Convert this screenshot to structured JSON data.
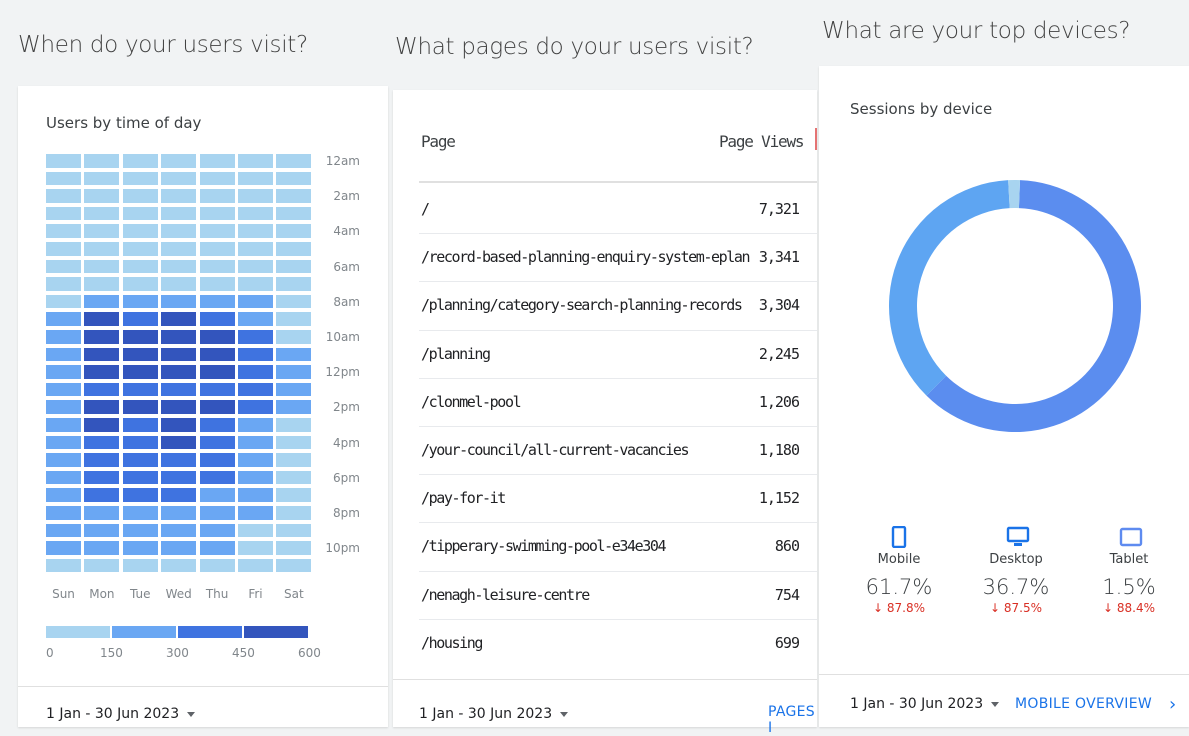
{
  "panels": {
    "visits": {
      "heading": "When do your users visit?",
      "card_title": "Users by time of day",
      "hour_labels": [
        "12am",
        "2am",
        "4am",
        "6am",
        "8am",
        "10am",
        "12pm",
        "2pm",
        "4pm",
        "6pm",
        "8pm",
        "10pm"
      ],
      "days": [
        "Sun",
        "Mon",
        "Tue",
        "Wed",
        "Thu",
        "Fri",
        "Sat"
      ],
      "legend_ticks": [
        "0",
        "150",
        "300",
        "450",
        "600"
      ],
      "legend_colors": [
        "#a8d4f0",
        "#6aa7f3",
        "#3f73e0",
        "#3355bd"
      ],
      "date_range": "1 Jan - 30 Jun 2023"
    },
    "pages": {
      "heading": "What pages do your users visit?",
      "col_page": "Page",
      "col_views": "Page Views",
      "rows": [
        {
          "page": "/",
          "views": "7,321"
        },
        {
          "page": "/record-based-planning-enquiry-system-eplan",
          "views": "3,341"
        },
        {
          "page": "/planning/category-search-planning-records",
          "views": "3,304"
        },
        {
          "page": "/planning",
          "views": "2,245"
        },
        {
          "page": "/clonmel-pool",
          "views": "1,206"
        },
        {
          "page": "/your-council/all-current-vacancies",
          "views": "1,180"
        },
        {
          "page": "/pay-for-it",
          "views": "1,152"
        },
        {
          "page": "/tipperary-swimming-pool-e34e304",
          "views": "860"
        },
        {
          "page": "/nenagh-leisure-centre",
          "views": "754"
        },
        {
          "page": "/housing",
          "views": "699"
        }
      ],
      "date_range": "1 Jan - 30 Jun 2023",
      "link": "PAGES I"
    },
    "devices": {
      "heading": "What are your top devices?",
      "card_title": "Sessions by device",
      "items": [
        {
          "name": "Mobile",
          "pct": "61.7%",
          "change": "↓ 87.8%",
          "share": 61.7,
          "color": "#5b8def",
          "icon": "phone-icon"
        },
        {
          "name": "Desktop",
          "pct": "36.7%",
          "change": "↓ 87.5%",
          "share": 36.7,
          "color": "#5ea5f2",
          "icon": "desktop-icon"
        },
        {
          "name": "Tablet",
          "pct": "1.5%",
          "change": "↓ 88.4%",
          "share": 1.5,
          "color": "#a8d4f0",
          "icon": "tablet-icon"
        }
      ],
      "date_range": "1 Jan - 30 Jun 2023",
      "link": "MOBILE OVERVIEW"
    }
  },
  "chart_data": [
    {
      "type": "heatmap",
      "title": "Users by time of day",
      "x": [
        "Sun",
        "Mon",
        "Tue",
        "Wed",
        "Thu",
        "Fri",
        "Sat"
      ],
      "y": [
        "12am",
        "1am",
        "2am",
        "3am",
        "4am",
        "5am",
        "6am",
        "7am",
        "8am",
        "9am",
        "10am",
        "11am",
        "12pm",
        "1pm",
        "2pm",
        "3pm",
        "4pm",
        "5pm",
        "6pm",
        "7pm",
        "8pm",
        "9pm",
        "10pm",
        "11pm"
      ],
      "scale": [
        0,
        600
      ],
      "levels": [
        [
          0,
          0,
          0,
          0,
          0,
          0,
          0
        ],
        [
          0,
          0,
          0,
          0,
          0,
          0,
          0
        ],
        [
          0,
          0,
          0,
          0,
          0,
          0,
          0
        ],
        [
          0,
          0,
          0,
          0,
          0,
          0,
          0
        ],
        [
          0,
          0,
          0,
          0,
          0,
          0,
          0
        ],
        [
          0,
          0,
          0,
          0,
          0,
          0,
          0
        ],
        [
          0,
          0,
          0,
          0,
          0,
          0,
          0
        ],
        [
          0,
          0,
          0,
          0,
          0,
          0,
          0
        ],
        [
          0,
          1,
          1,
          1,
          1,
          1,
          0
        ],
        [
          1,
          3,
          2,
          3,
          2,
          1,
          0
        ],
        [
          1,
          3,
          3,
          3,
          3,
          2,
          0
        ],
        [
          1,
          3,
          3,
          3,
          3,
          2,
          1
        ],
        [
          1,
          3,
          3,
          3,
          3,
          2,
          1
        ],
        [
          1,
          2,
          2,
          2,
          2,
          2,
          1
        ],
        [
          1,
          3,
          3,
          3,
          3,
          2,
          1
        ],
        [
          1,
          3,
          2,
          3,
          2,
          1,
          0
        ],
        [
          1,
          2,
          2,
          3,
          2,
          1,
          0
        ],
        [
          1,
          2,
          2,
          2,
          2,
          1,
          0
        ],
        [
          1,
          2,
          2,
          2,
          2,
          1,
          0
        ],
        [
          1,
          2,
          2,
          2,
          1,
          1,
          0
        ],
        [
          1,
          1,
          1,
          1,
          1,
          1,
          0
        ],
        [
          1,
          1,
          1,
          1,
          1,
          0,
          0
        ],
        [
          1,
          1,
          1,
          1,
          1,
          0,
          0
        ],
        [
          0,
          0,
          0,
          0,
          0,
          0,
          0
        ]
      ]
    },
    {
      "type": "pie",
      "title": "Sessions by device",
      "categories": [
        "Mobile",
        "Desktop",
        "Tablet"
      ],
      "values": [
        61.7,
        36.7,
        1.5
      ]
    }
  ]
}
